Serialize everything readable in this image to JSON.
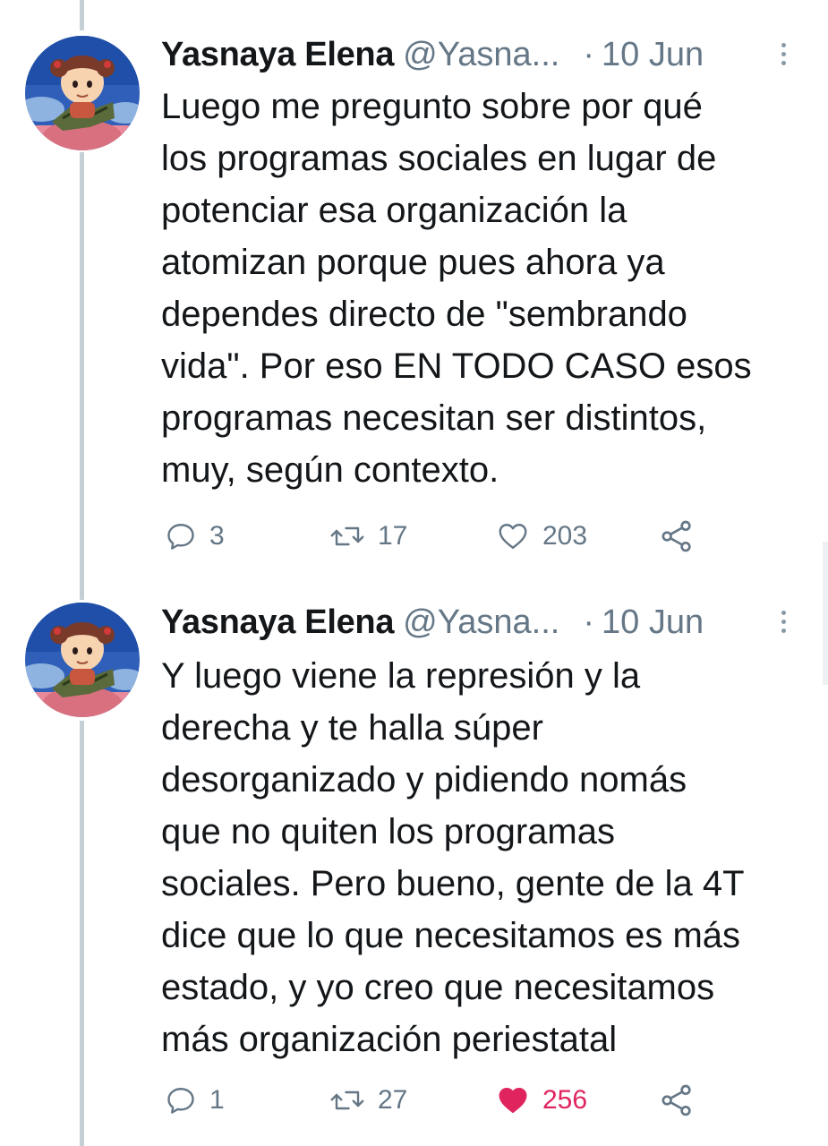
{
  "tweets": [
    {
      "name": "Yasnaya Elena",
      "handle": "@Yasna...",
      "separator": "·",
      "date": "10 Jun",
      "avatar_icon": "avatar-girl-illustration",
      "text": "Luego me pregunto sobre  por qué\nlos programas sociales en lugar de\npotenciar esa organización la\natomizan porque pues ahora ya\ndependes directo de \"sembrando\nvida\". Por eso EN TODO CASO esos\nprogramas necesitan ser distintos,\nmuy, según contexto.",
      "replies": "3",
      "retweets": "17",
      "likes": "203",
      "liked": false
    },
    {
      "name": "Yasnaya Elena",
      "handle": "@Yasna...",
      "separator": "·",
      "date": "10 Jun",
      "avatar_icon": "avatar-girl-illustration",
      "text": "Y luego viene la represión y la\nderecha y te halla súper\ndesorganizado y pidiendo nomás\nque no quiten los programas\nsociales. Pero bueno, gente de la 4T\ndice que lo que necesitamos es más\nestado, y yo creo que necesitamos\nmás organización periestatal",
      "replies": "1",
      "retweets": "27",
      "likes": "256",
      "liked": true
    }
  ],
  "colors": {
    "text": "#14171a",
    "secondary": "#657786",
    "thread_line": "#c4cfd6",
    "like_active": "#e0245e"
  },
  "icons": {
    "reply": "reply-icon",
    "retweet": "retweet-icon",
    "like": "heart-icon",
    "share": "share-icon",
    "more": "more-options-icon"
  }
}
